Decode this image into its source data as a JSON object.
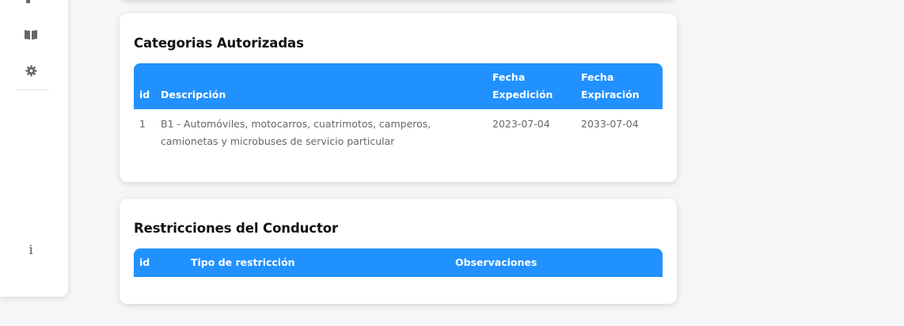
{
  "sidebar": {
    "icons": [
      {
        "name": "share-icon"
      },
      {
        "name": "book-icon"
      },
      {
        "name": "gear-icon"
      },
      {
        "name": "info-icon",
        "glyph": "i"
      }
    ]
  },
  "categorias": {
    "title": "Categorias Autorizadas",
    "headers": {
      "id": "id",
      "descripcion": "Descripción",
      "fecha_expedicion_1": "Fecha",
      "fecha_expedicion_2": "Expedición",
      "fecha_expiracion_1": "Fecha",
      "fecha_expiracion_2": "Expiración"
    },
    "rows": [
      {
        "id": "1",
        "descripcion_1": "B1 - Automóviles, motocarros, cuatrimotos, camperos,",
        "descripcion_2": "camionetas y microbuses de servicio particular",
        "fecha_expedicion": "2023-07-04",
        "fecha_expiracion": "2033-07-04"
      }
    ]
  },
  "restricciones": {
    "title": "Restricciones del Conductor",
    "headers": {
      "id": "id",
      "tipo": "Tipo de restricción",
      "observaciones": "Observaciones"
    }
  }
}
